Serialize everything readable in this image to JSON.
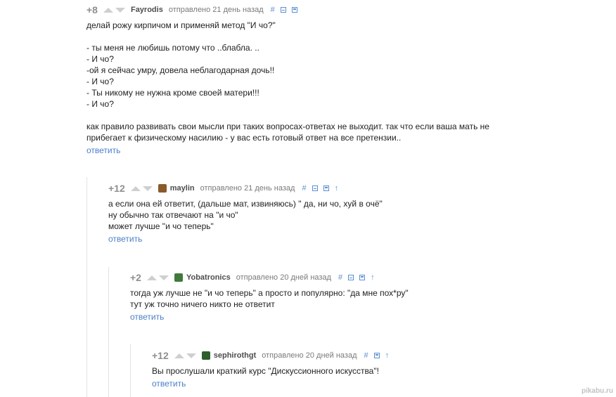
{
  "comments": [
    {
      "rating": "+8",
      "author": "Fayrodis",
      "sent": "отправлено 21 день назад",
      "lines": [
        "делай рожу кирпичом и применяй метод \"И чо?\"",
        "",
        "- ты меня не любишь потому что ..блабла. ..",
        "- И чо?",
        "-ой я сейчас умру, довела неблагодарная дочь!!",
        "- И чо?",
        "- Ты никому не нужна кроме своей матери!!!",
        "- И чо?",
        "",
        "как правило развивать свои мысли при таких вопросах-ответах не выходит. так что если ваша мать не",
        "прибегает к физическому насилию - у вас есть готовый ответ на все претензии.."
      ],
      "reply": "ответить"
    },
    {
      "rating": "+12",
      "author": "maylin",
      "sent": "отправлено 21 день назад",
      "lines": [
        "а если она ей ответит, (дальше мат, извиняюсь) \" да, ни чо, хуй в очё\"",
        "ну обычно так отвечают на \"и чо\"",
        "может лучше \"и чо теперь\""
      ],
      "reply": "ответить"
    },
    {
      "rating": "+2",
      "author": "Yobatronics",
      "sent": "отправлено 20 дней назад",
      "lines": [
        "тогда уж лучше не \"и чо теперь\" а просто и популярно: \"да мне пох*ру\"",
        "тут уж точно ничего никто не ответит"
      ],
      "reply": "ответить"
    },
    {
      "rating": "+12",
      "author": "sephirothgt",
      "sent": "отправлено 20 дней назад",
      "lines": [
        "Вы прослушали краткий курс \"Дискуссионного искусства\"!"
      ],
      "reply": "ответить"
    }
  ],
  "icons": {
    "link": "#",
    "parent": "↑"
  },
  "colors": {
    "link": "#4a7fc8",
    "meta": "#7a7a7a"
  },
  "watermark": "pikabu.ru"
}
